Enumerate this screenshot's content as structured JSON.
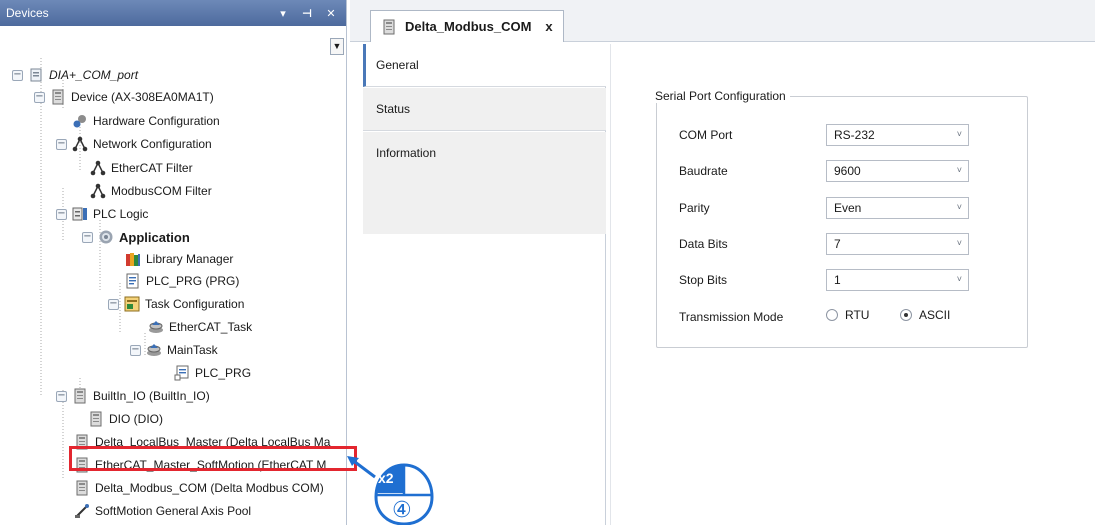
{
  "devices_panel": {
    "title": "Devices",
    "pin_glyph": "▾ ⊣",
    "close_glyph": "✕"
  },
  "tree": {
    "root": "DIA+_COM_port",
    "device": "Device (AX-308EA0MA1T)",
    "hardware_config": "Hardware Configuration",
    "network_config": "Network Configuration",
    "ethercat_filter": "EtherCAT Filter",
    "modbuscom_filter": "ModbusCOM Filter",
    "plc_logic": "PLC Logic",
    "application": "Application",
    "library_manager": "Library Manager",
    "plc_prg_prg": "PLC_PRG (PRG)",
    "task_config": "Task Configuration",
    "ethercat_task": "EtherCAT_Task",
    "main_task": "MainTask",
    "plc_prg": "PLC_PRG",
    "builtin_io": "BuiltIn_IO (BuiltIn_IO)",
    "dio": "DIO (DIO)",
    "localbus_master": "Delta_LocalBus_Master (Delta LocalBus Ma",
    "ethercat_master": "EtherCAT_Master_SoftMotion (EtherCAT M",
    "modbus_com": "Delta_Modbus_COM (Delta Modbus COM)",
    "axis_pool": "SoftMotion General Axis Pool"
  },
  "callout": {
    "count": "x2",
    "step": "④"
  },
  "editor": {
    "tab_title": "Delta_Modbus_COM",
    "tab_close": "x",
    "vtabs": [
      "General",
      "Status",
      "Information"
    ]
  },
  "serial": {
    "group_title": "Serial Port Configuration",
    "com_port_label": "COM Port",
    "com_port_value": "RS-232",
    "baudrate_label": "Baudrate",
    "baudrate_value": "9600",
    "parity_label": "Parity",
    "parity_value": "Even",
    "data_bits_label": "Data Bits",
    "data_bits_value": "7",
    "stop_bits_label": "Stop Bits",
    "stop_bits_value": "1",
    "transmission_label": "Transmission Mode",
    "mode_rtu": "RTU",
    "mode_ascii": "ASCII",
    "selected_mode": "ASCII"
  },
  "colors": {
    "header_blue": "#5874a8",
    "highlight_red": "#e3262f",
    "callout_blue": "#1f6fd1"
  }
}
